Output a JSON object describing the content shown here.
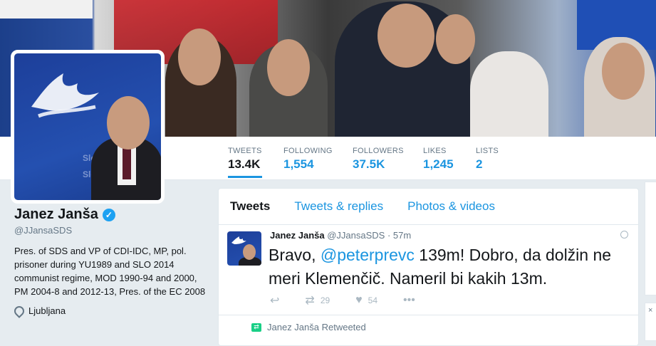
{
  "profile": {
    "name": "Janez Janša",
    "handle": "@JJansaSDS",
    "bio": "Pres. of SDS and VP of CDI-IDC, MP, pol. prisoner during YU1989 and SLO 2014 communist regime, MOD 1990-94 and 2000, PM 2004-8 and 2012-13, Pres. of the EC 2008",
    "location": "Ljubljana",
    "avatar_text_1": "Slove",
    "avatar_text_2": "Slo"
  },
  "stats": [
    {
      "label": "TWEETS",
      "value": "13.4K"
    },
    {
      "label": "FOLLOWING",
      "value": "1,554"
    },
    {
      "label": "FOLLOWERS",
      "value": "37.5K"
    },
    {
      "label": "LIKES",
      "value": "1,245"
    },
    {
      "label": "LISTS",
      "value": "2"
    }
  ],
  "tabs": [
    "Tweets",
    "Tweets & replies",
    "Photos & videos"
  ],
  "tweet": {
    "author": "Janez Janša",
    "handle": "@JJansaSDS",
    "time": "· 57m",
    "text_before": "Bravo, ",
    "mention": "@peterprevc",
    "text_after": " 139m! Dobro, da dolžin ne meri Klemenčič. Nameril bi kakih 13m.",
    "retweets": "29",
    "likes": "54"
  },
  "retweeted_label": "Janez Janša Retweeted",
  "colors": {
    "accent": "#1b95e0",
    "verified": "#1da1f2",
    "retweet": "#19cf86"
  }
}
